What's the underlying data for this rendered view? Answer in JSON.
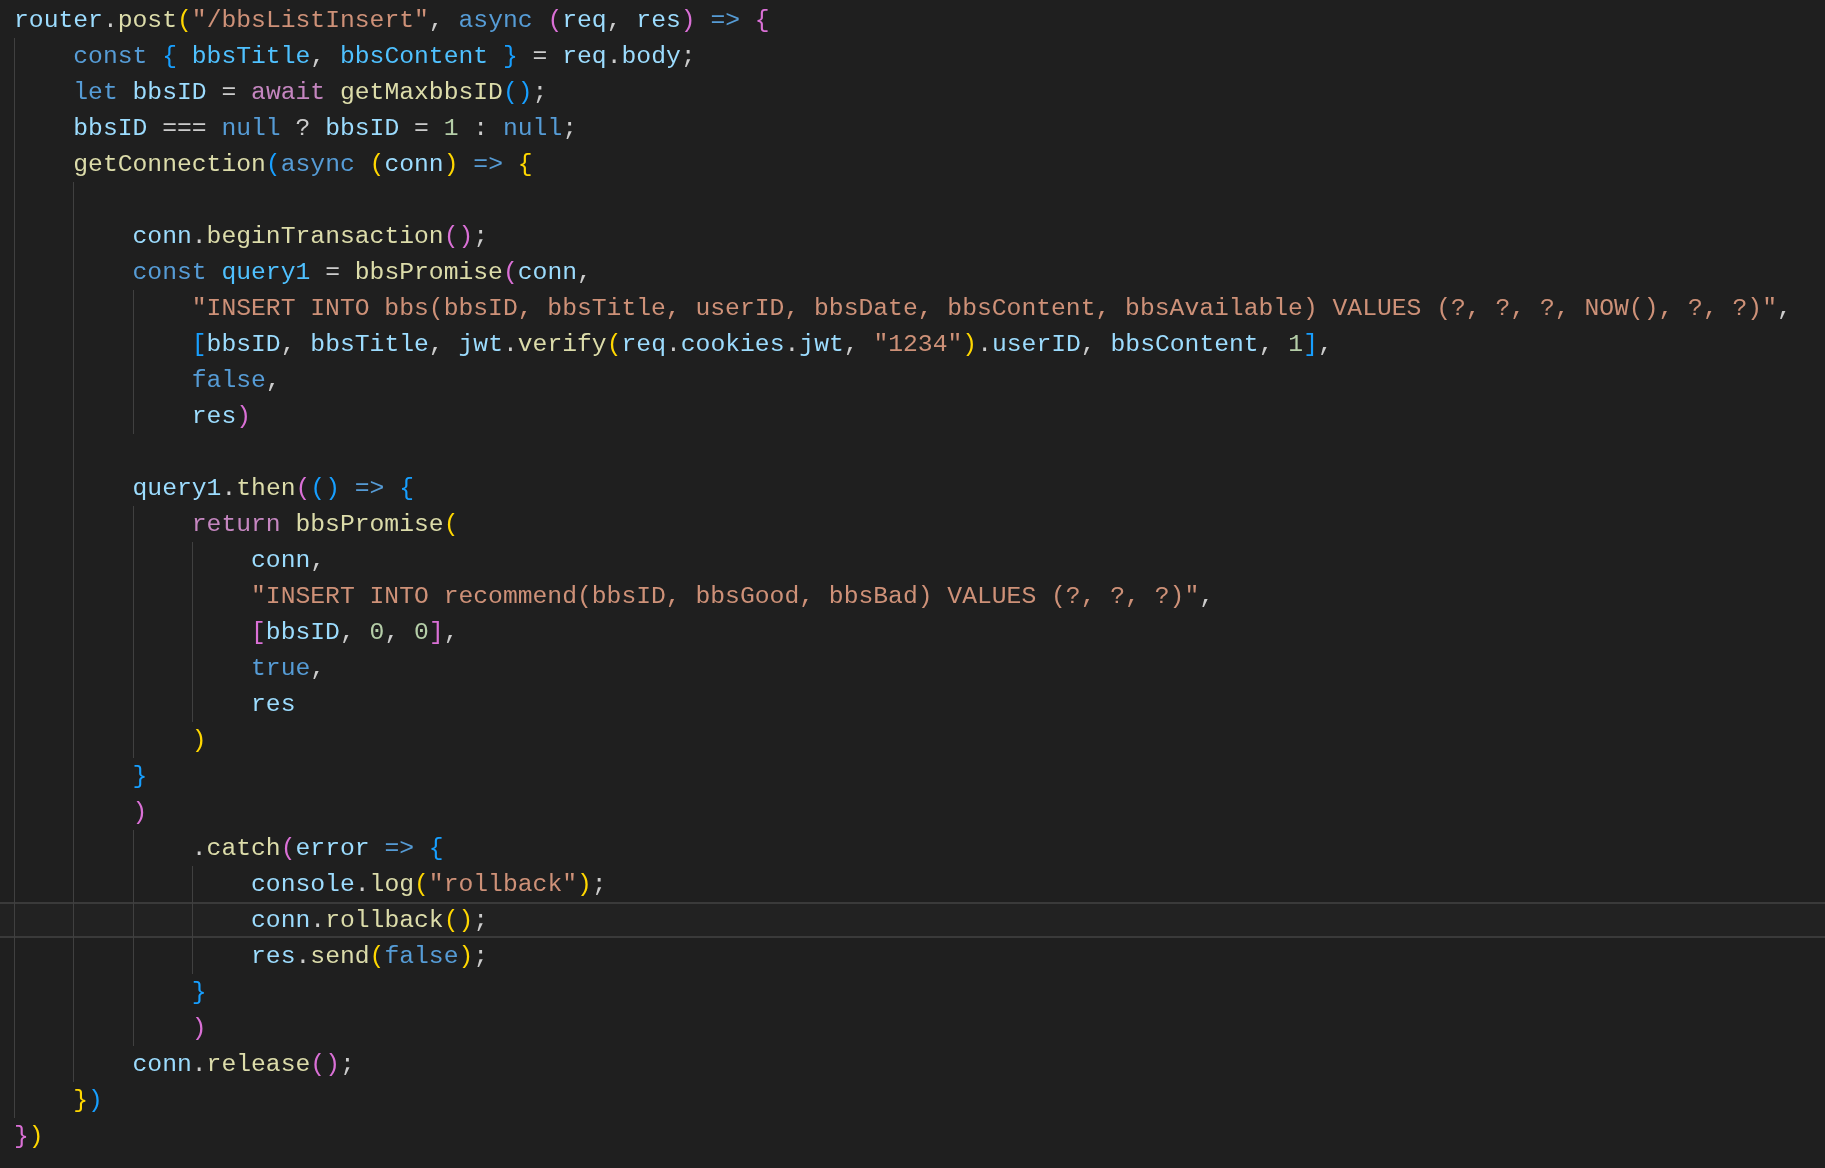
{
  "editor": {
    "lines": [
      {
        "current_line": false,
        "tokens": [
          {
            "kind": "variable",
            "text": "router"
          },
          {
            "kind": "punct",
            "text": "."
          },
          {
            "kind": "function",
            "text": "post"
          },
          {
            "kind": "bracket1",
            "text": "("
          },
          {
            "kind": "string",
            "text": "\"/bbsListInsert\""
          },
          {
            "kind": "punct",
            "text": ", "
          },
          {
            "kind": "keyword",
            "text": "async "
          },
          {
            "kind": "bracket2",
            "text": "("
          },
          {
            "kind": "variable",
            "text": "req"
          },
          {
            "kind": "punct",
            "text": ", "
          },
          {
            "kind": "variable",
            "text": "res"
          },
          {
            "kind": "bracket2",
            "text": ")"
          },
          {
            "kind": "keyword",
            "text": " => "
          },
          {
            "kind": "bracket2",
            "text": "{"
          }
        ]
      },
      {
        "current_line": false,
        "tokens": [
          {
            "kind": "keyword",
            "text": "    const "
          },
          {
            "kind": "bracket3",
            "text": "{ "
          },
          {
            "kind": "constant",
            "text": "bbsTitle"
          },
          {
            "kind": "punct",
            "text": ", "
          },
          {
            "kind": "constant",
            "text": "bbsContent "
          },
          {
            "kind": "bracket3",
            "text": "}"
          },
          {
            "kind": "punct",
            "text": " = "
          },
          {
            "kind": "variable",
            "text": "req"
          },
          {
            "kind": "punct",
            "text": "."
          },
          {
            "kind": "variable",
            "text": "body"
          },
          {
            "kind": "punct",
            "text": ";"
          }
        ]
      },
      {
        "current_line": false,
        "tokens": [
          {
            "kind": "keyword",
            "text": "    let "
          },
          {
            "kind": "variable",
            "text": "bbsID"
          },
          {
            "kind": "punct",
            "text": " = "
          },
          {
            "kind": "control",
            "text": "await "
          },
          {
            "kind": "function",
            "text": "getMaxbbsID"
          },
          {
            "kind": "bracket3",
            "text": "()"
          },
          {
            "kind": "punct",
            "text": ";"
          }
        ]
      },
      {
        "current_line": false,
        "tokens": [
          {
            "kind": "variable",
            "text": "    bbsID"
          },
          {
            "kind": "punct",
            "text": " === "
          },
          {
            "kind": "keyword",
            "text": "null"
          },
          {
            "kind": "punct",
            "text": " ? "
          },
          {
            "kind": "variable",
            "text": "bbsID"
          },
          {
            "kind": "punct",
            "text": " = "
          },
          {
            "kind": "number",
            "text": "1"
          },
          {
            "kind": "punct",
            "text": " : "
          },
          {
            "kind": "keyword",
            "text": "null"
          },
          {
            "kind": "punct",
            "text": ";"
          }
        ]
      },
      {
        "current_line": false,
        "tokens": [
          {
            "kind": "function",
            "text": "    getConnection"
          },
          {
            "kind": "bracket3",
            "text": "("
          },
          {
            "kind": "keyword",
            "text": "async "
          },
          {
            "kind": "bracket1",
            "text": "("
          },
          {
            "kind": "variable",
            "text": "conn"
          },
          {
            "kind": "bracket1",
            "text": ")"
          },
          {
            "kind": "keyword",
            "text": " => "
          },
          {
            "kind": "bracket1",
            "text": "{"
          }
        ]
      },
      {
        "current_line": false
      },
      {
        "current_line": false,
        "tokens": [
          {
            "kind": "variable",
            "text": "        conn"
          },
          {
            "kind": "punct",
            "text": "."
          },
          {
            "kind": "function",
            "text": "beginTransaction"
          },
          {
            "kind": "bracket2",
            "text": "()"
          },
          {
            "kind": "punct",
            "text": ";"
          }
        ]
      },
      {
        "current_line": false,
        "tokens": [
          {
            "kind": "keyword",
            "text": "        const "
          },
          {
            "kind": "constant",
            "text": "query1"
          },
          {
            "kind": "punct",
            "text": " = "
          },
          {
            "kind": "function",
            "text": "bbsPromise"
          },
          {
            "kind": "bracket2",
            "text": "("
          },
          {
            "kind": "variable",
            "text": "conn"
          },
          {
            "kind": "punct",
            "text": ","
          }
        ]
      },
      {
        "current_line": false,
        "tokens": [
          {
            "kind": "string",
            "text": "            \"INSERT INTO bbs(bbsID, bbsTitle, userID, bbsDate, bbsContent, bbsAvailable) VALUES (?, ?, ?, NOW(), ?, ?)\""
          },
          {
            "kind": "punct",
            "text": ","
          }
        ]
      },
      {
        "current_line": false,
        "tokens": [
          {
            "kind": "bracket3",
            "text": "            ["
          },
          {
            "kind": "variable",
            "text": "bbsID"
          },
          {
            "kind": "punct",
            "text": ", "
          },
          {
            "kind": "variable",
            "text": "bbsTitle"
          },
          {
            "kind": "punct",
            "text": ", "
          },
          {
            "kind": "variable",
            "text": "jwt"
          },
          {
            "kind": "punct",
            "text": "."
          },
          {
            "kind": "function",
            "text": "verify"
          },
          {
            "kind": "bracket1",
            "text": "("
          },
          {
            "kind": "variable",
            "text": "req"
          },
          {
            "kind": "punct",
            "text": "."
          },
          {
            "kind": "variable",
            "text": "cookies"
          },
          {
            "kind": "punct",
            "text": "."
          },
          {
            "kind": "variable",
            "text": "jwt"
          },
          {
            "kind": "punct",
            "text": ", "
          },
          {
            "kind": "string",
            "text": "\"1234\""
          },
          {
            "kind": "bracket1",
            "text": ")"
          },
          {
            "kind": "punct",
            "text": "."
          },
          {
            "kind": "variable",
            "text": "userID"
          },
          {
            "kind": "punct",
            "text": ", "
          },
          {
            "kind": "variable",
            "text": "bbsContent"
          },
          {
            "kind": "punct",
            "text": ", "
          },
          {
            "kind": "number",
            "text": "1"
          },
          {
            "kind": "bracket3",
            "text": "]"
          },
          {
            "kind": "punct",
            "text": ","
          }
        ]
      },
      {
        "current_line": false,
        "tokens": [
          {
            "kind": "keyword",
            "text": "            false"
          },
          {
            "kind": "punct",
            "text": ","
          }
        ]
      },
      {
        "current_line": false,
        "tokens": [
          {
            "kind": "variable",
            "text": "            res"
          },
          {
            "kind": "bracket2",
            "text": ")"
          }
        ]
      },
      {
        "current_line": false
      },
      {
        "current_line": false,
        "tokens": [
          {
            "kind": "variable",
            "text": "        query1"
          },
          {
            "kind": "punct",
            "text": "."
          },
          {
            "kind": "function",
            "text": "then"
          },
          {
            "kind": "bracket2",
            "text": "("
          },
          {
            "kind": "bracket3",
            "text": "()"
          },
          {
            "kind": "keyword",
            "text": " => "
          },
          {
            "kind": "bracket3",
            "text": "{"
          }
        ]
      },
      {
        "current_line": false,
        "tokens": [
          {
            "kind": "control",
            "text": "            return "
          },
          {
            "kind": "function",
            "text": "bbsPromise"
          },
          {
            "kind": "bracket1",
            "text": "("
          }
        ]
      },
      {
        "current_line": false,
        "tokens": [
          {
            "kind": "variable",
            "text": "                conn"
          },
          {
            "kind": "punct",
            "text": ","
          }
        ]
      },
      {
        "current_line": false,
        "tokens": [
          {
            "kind": "string",
            "text": "                \"INSERT INTO recommend(bbsID, bbsGood, bbsBad) VALUES (?, ?, ?)\""
          },
          {
            "kind": "punct",
            "text": ","
          }
        ]
      },
      {
        "current_line": false,
        "tokens": [
          {
            "kind": "bracket2",
            "text": "                ["
          },
          {
            "kind": "variable",
            "text": "bbsID"
          },
          {
            "kind": "punct",
            "text": ", "
          },
          {
            "kind": "number",
            "text": "0"
          },
          {
            "kind": "punct",
            "text": ", "
          },
          {
            "kind": "number",
            "text": "0"
          },
          {
            "kind": "bracket2",
            "text": "]"
          },
          {
            "kind": "punct",
            "text": ","
          }
        ]
      },
      {
        "current_line": false,
        "tokens": [
          {
            "kind": "keyword",
            "text": "                true"
          },
          {
            "kind": "punct",
            "text": ","
          }
        ]
      },
      {
        "current_line": false,
        "tokens": [
          {
            "kind": "variable",
            "text": "                res"
          }
        ]
      },
      {
        "current_line": false,
        "tokens": [
          {
            "kind": "bracket1",
            "text": "            )"
          }
        ]
      },
      {
        "current_line": false,
        "tokens": [
          {
            "kind": "bracket3",
            "text": "        }"
          }
        ]
      },
      {
        "current_line": false,
        "tokens": [
          {
            "kind": "bracket2",
            "text": "        )"
          }
        ]
      },
      {
        "current_line": false,
        "tokens": [
          {
            "kind": "punct",
            "text": "            ."
          },
          {
            "kind": "function",
            "text": "catch"
          },
          {
            "kind": "bracket2",
            "text": "("
          },
          {
            "kind": "variable",
            "text": "error"
          },
          {
            "kind": "keyword",
            "text": " => "
          },
          {
            "kind": "bracket3",
            "text": "{"
          }
        ]
      },
      {
        "current_line": false,
        "tokens": [
          {
            "kind": "variable",
            "text": "                console"
          },
          {
            "kind": "punct",
            "text": "."
          },
          {
            "kind": "function",
            "text": "log"
          },
          {
            "kind": "bracket1",
            "text": "("
          },
          {
            "kind": "string",
            "text": "\"rollback\""
          },
          {
            "kind": "bracket1",
            "text": ")"
          },
          {
            "kind": "punct",
            "text": ";"
          }
        ]
      },
      {
        "current_line": true,
        "tokens": [
          {
            "kind": "variable",
            "text": "                conn"
          },
          {
            "kind": "punct",
            "text": "."
          },
          {
            "kind": "function",
            "text": "rollback"
          },
          {
            "kind": "bracket1",
            "text": "()"
          },
          {
            "kind": "punct",
            "text": ";"
          }
        ]
      },
      {
        "current_line": false,
        "tokens": [
          {
            "kind": "variable",
            "text": "                res"
          },
          {
            "kind": "punct",
            "text": "."
          },
          {
            "kind": "function",
            "text": "send"
          },
          {
            "kind": "bracket1",
            "text": "("
          },
          {
            "kind": "keyword",
            "text": "false"
          },
          {
            "kind": "bracket1",
            "text": ")"
          },
          {
            "kind": "punct",
            "text": ";"
          }
        ]
      },
      {
        "current_line": false,
        "tokens": [
          {
            "kind": "bracket3",
            "text": "            }"
          }
        ]
      },
      {
        "current_line": false,
        "tokens": [
          {
            "kind": "bracket2",
            "text": "            )"
          }
        ]
      },
      {
        "current_line": false,
        "tokens": [
          {
            "kind": "variable",
            "text": "        conn"
          },
          {
            "kind": "punct",
            "text": "."
          },
          {
            "kind": "function",
            "text": "release"
          },
          {
            "kind": "bracket2",
            "text": "()"
          },
          {
            "kind": "punct",
            "text": ";"
          }
        ]
      },
      {
        "current_line": false,
        "tokens": [
          {
            "kind": "bracket1",
            "text": "    }"
          },
          {
            "kind": "bracket3",
            "text": ")"
          }
        ]
      },
      {
        "current_line": false,
        "tokens": [
          {
            "kind": "bracket2",
            "text": "}"
          },
          {
            "kind": "bracket1",
            "text": ")"
          }
        ]
      }
    ]
  }
}
